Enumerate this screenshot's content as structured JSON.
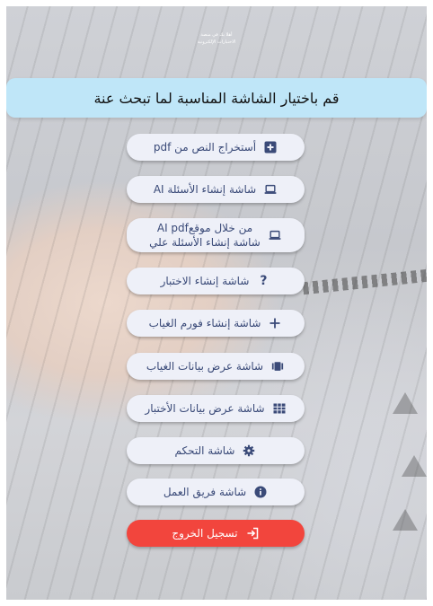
{
  "welcome": {
    "line1": "أهلا بك في منصة",
    "line2": "الاختبارات الإلكترونية"
  },
  "header": {
    "title": "قم باختيار الشاشة المناسبة لما تبحث عنة"
  },
  "menu": [
    {
      "label": "أستخراج النص من pdf",
      "icon": "plus-square-icon"
    },
    {
      "label": "شاشة إنشاء الأسئلة AI",
      "icon": "laptop-icon"
    },
    {
      "label_line1": "من خلال موقعAI pdf",
      "label_line2": "شاشة إنشاء الأسئلة علي",
      "icon": "laptop-icon"
    },
    {
      "label": "شاشة إنشاء الاختبار",
      "icon": "question-icon"
    },
    {
      "label": "شاشة إنشاء فورم الغياب",
      "icon": "plus-icon"
    },
    {
      "label": "شاشة عرض بيانات الغياب",
      "icon": "attendance-icon"
    },
    {
      "label": "شاشة عرض بيانات الأختبار",
      "icon": "table-icon"
    },
    {
      "label": "شاشة التحكم",
      "icon": "gear-icon"
    },
    {
      "label": "شاشة فريق العمل",
      "icon": "info-icon"
    },
    {
      "label": "تسجيل الخروج",
      "icon": "logout-icon"
    }
  ],
  "colors": {
    "header_bg": "#bfe6f8",
    "button_bg": "#eef0f8",
    "button_text": "#3a4a78",
    "logout_bg": "#f2453d"
  }
}
